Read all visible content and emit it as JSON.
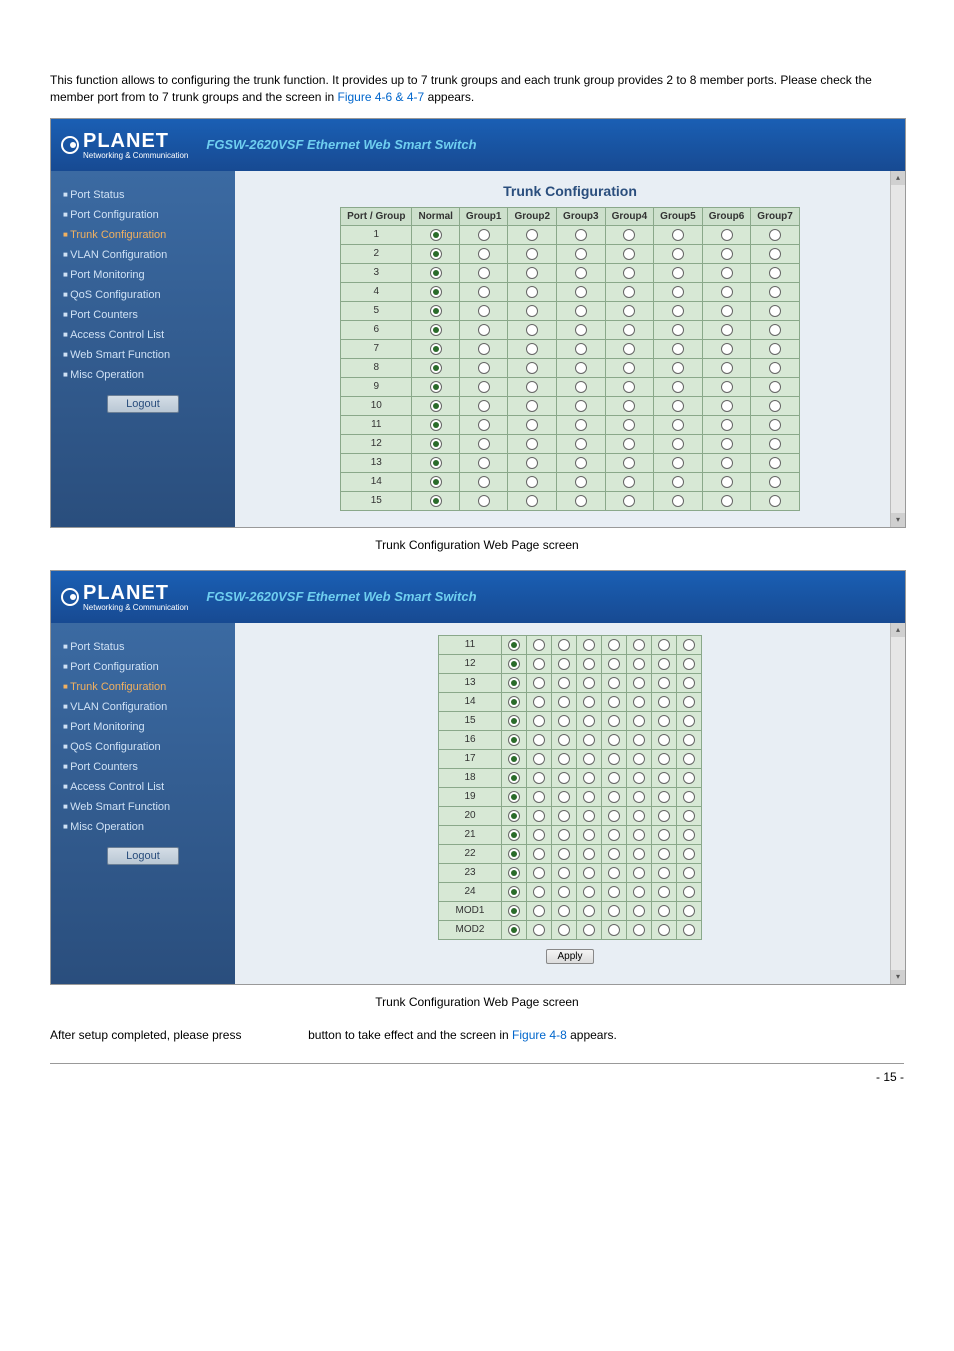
{
  "intro_para_1": "This function allows to configuring the trunk function. It provides up to 7 trunk groups and each trunk group provides 2 to 8 member ports. Please check the member port from ",
  "intro_para_2": " to 7 trunk groups and the screen in ",
  "intro_link": "Figure 4-6 & 4-7",
  "intro_para_3": " appears.",
  "brand": "PLANET",
  "brand_sub": "Networking & Communication",
  "product_title": "FGSW-2620VSF Ethernet Web Smart Switch",
  "sidebar": {
    "items": [
      "Port Status",
      "Port Configuration",
      "Trunk Configuration",
      "VLAN Configuration",
      "Port Monitoring",
      "QoS Configuration",
      "Port Counters",
      "Access Control List",
      "Web Smart Function",
      "Misc Operation"
    ],
    "logout": "Logout"
  },
  "content_title": "Trunk Configuration",
  "table": {
    "headers": [
      "Port / Group",
      "Normal",
      "Group1",
      "Group2",
      "Group3",
      "Group4",
      "Group5",
      "Group6",
      "Group7"
    ]
  },
  "rows_top": [
    "1",
    "2",
    "3",
    "4",
    "5",
    "6",
    "7",
    "8",
    "9",
    "10",
    "11",
    "12",
    "13",
    "14",
    "15"
  ],
  "rows_bottom": [
    "11",
    "12",
    "13",
    "14",
    "15",
    "16",
    "17",
    "18",
    "19",
    "20",
    "21",
    "22",
    "23",
    "24",
    "MOD1",
    "MOD2"
  ],
  "apply_label": "Apply",
  "caption1": "Trunk Configuration Web Page screen",
  "caption2": "Trunk Configuration Web Page screen",
  "after_para_1": "After setup completed, please press ",
  "after_para_2": " button to take effect and the screen in ",
  "after_link": "Figure 4-8",
  "after_para_3": " appears.",
  "page_number": "- 15 -",
  "chart_data": {
    "type": "table",
    "description": "Trunk Configuration radio-button matrix. Each port row has a radio selection across Normal and Group1..Group7. All ports default to Normal.",
    "columns": [
      "Port / Group",
      "Normal",
      "Group1",
      "Group2",
      "Group3",
      "Group4",
      "Group5",
      "Group6",
      "Group7"
    ],
    "screenshot_top_rows": [
      {
        "port": "1",
        "selected": "Normal"
      },
      {
        "port": "2",
        "selected": "Normal"
      },
      {
        "port": "3",
        "selected": "Normal"
      },
      {
        "port": "4",
        "selected": "Normal"
      },
      {
        "port": "5",
        "selected": "Normal"
      },
      {
        "port": "6",
        "selected": "Normal"
      },
      {
        "port": "7",
        "selected": "Normal"
      },
      {
        "port": "8",
        "selected": "Normal"
      },
      {
        "port": "9",
        "selected": "Normal"
      },
      {
        "port": "10",
        "selected": "Normal"
      },
      {
        "port": "11",
        "selected": "Normal"
      },
      {
        "port": "12",
        "selected": "Normal"
      },
      {
        "port": "13",
        "selected": "Normal"
      },
      {
        "port": "14",
        "selected": "Normal"
      },
      {
        "port": "15",
        "selected": "Normal"
      }
    ],
    "screenshot_bottom_rows": [
      {
        "port": "11",
        "selected": "Normal"
      },
      {
        "port": "12",
        "selected": "Normal"
      },
      {
        "port": "13",
        "selected": "Normal"
      },
      {
        "port": "14",
        "selected": "Normal"
      },
      {
        "port": "15",
        "selected": "Normal"
      },
      {
        "port": "16",
        "selected": "Normal"
      },
      {
        "port": "17",
        "selected": "Normal"
      },
      {
        "port": "18",
        "selected": "Normal"
      },
      {
        "port": "19",
        "selected": "Normal"
      },
      {
        "port": "20",
        "selected": "Normal"
      },
      {
        "port": "21",
        "selected": "Normal"
      },
      {
        "port": "22",
        "selected": "Normal"
      },
      {
        "port": "23",
        "selected": "Normal"
      },
      {
        "port": "24",
        "selected": "Normal"
      },
      {
        "port": "MOD1",
        "selected": "Normal"
      },
      {
        "port": "MOD2",
        "selected": "Normal"
      }
    ]
  }
}
